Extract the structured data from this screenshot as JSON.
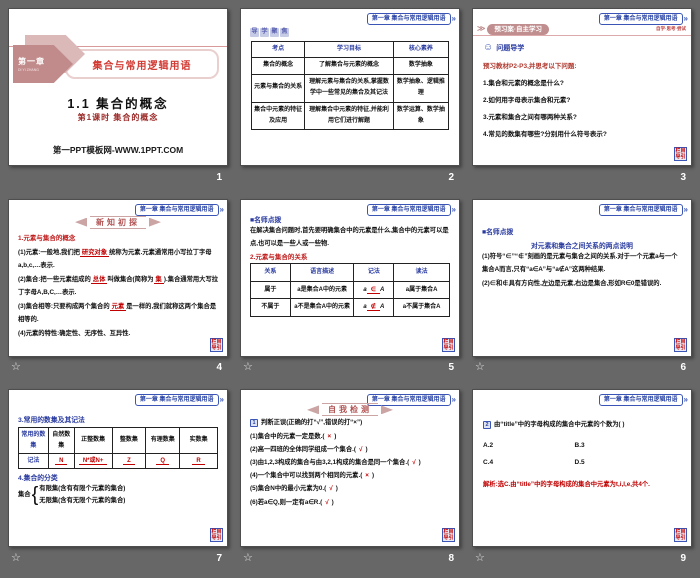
{
  "icons": {
    "chevron": "»",
    "section_chevron": "≫",
    "star": "☆",
    "smiley": "☺"
  },
  "chrome": {
    "chapter_header": "第一章 集合与常用逻辑用语",
    "corner_badge": "栏目导引"
  },
  "s1": {
    "number": "1",
    "chapter": "第一章",
    "chapter_pinyin": "DI YI ZHANG",
    "banner": "集合与常用逻辑用语",
    "title": "1.1 集合的概念",
    "subtitle": "第1课时 集合的概念",
    "footer": "第一PPT模板网-WWW.1PPT.COM"
  },
  "s2": {
    "number": "2",
    "badge": "导学聚焦",
    "headers": [
      "考点",
      "学习目标",
      "核心素养"
    ],
    "rows": [
      [
        "集合的概念",
        "了解集合与元素的概念",
        "数学抽象"
      ],
      [
        "元素与集合的关系",
        "理解元素与集合的关系,掌握数学中一些常见的集合及其记法",
        "数学抽象、逻辑推理"
      ],
      [
        "集合中元素的特征及应用",
        "理解集合中元素的特征,并能利用它们进行解题",
        "数学运算、数学抽象"
      ]
    ]
  },
  "s3": {
    "number": "3",
    "section": "预习案·自主学习",
    "tagline": "自学·思考·尝试",
    "heading": "问题导学",
    "intro": "预习教材P2-P3,并思考以下问题:",
    "items": [
      "1.集合和元素的概念是什么?",
      "2.如何用字母表示集合和元素?",
      "3.元素和集合之间有哪两种关系?",
      "4.常见的数集有哪些?分别用什么符号表示?"
    ]
  },
  "s4": {
    "number": "4",
    "badge": "新知初探",
    "heading": "1.元素与集合的概念",
    "p1a": "(1)元素:一般地,我们把",
    "p1b": "研究对象",
    "p1c": "统称为元素.元素通常用小写拉丁字母a,b,c,…表示.",
    "p2a": "(2)集合:把一些元素组成的",
    "p2b": "总体",
    "p2c": "叫做集合(简称为",
    "p2d": "集",
    "p2e": ").集合通常用大写拉丁字母A,B,C,…表示.",
    "p3a": "(3)集合相等:只要构成两个集合的",
    "p3b": "元素",
    "p3c": "是一样的,我们就称这两个集合是相等的.",
    "p4": "(4)元素的特性:确定性、无序性、互异性."
  },
  "s5": {
    "number": "5",
    "note_heading": "■名师点拨",
    "note_text": "在解决集合问题时,首先要明确集合中的元素是什么,集合中的元素可以是点,也可以是一些人或一些物.",
    "heading": "2.元素与集合的关系",
    "headers": [
      "关系",
      "语言描述",
      "记法",
      "读法"
    ],
    "r1": {
      "rel": "属于",
      "desc": "a是集合A中的元素",
      "pre": "a",
      "sym": "∈",
      "post": "A",
      "read": "a属于集合A"
    },
    "r2": {
      "rel": "不属于",
      "desc": "a不是集合A中的元素",
      "pre": "a",
      "sym": "∉",
      "post": "A",
      "read": "a不属于集合A"
    }
  },
  "s6": {
    "number": "6",
    "note_heading": "■名师点拨",
    "subtitle": "对元素和集合之间关系的两点说明",
    "p1": "(1)符号“∈”“∉”刻画的是元素与集合之间的关系.对于一个元素a与一个集合A而言,只有“a∈A”与“a∉A”这两种结果.",
    "p2": "(2)∈和∉具有方向性,左边是元素,右边是集合,形如R∈0是错误的."
  },
  "s7": {
    "number": "7",
    "heading": "3.常用的数集及其记法",
    "row1": [
      "常用的数集",
      "自然数集",
      "正整数集",
      "整数集",
      "有理数集",
      "实数集"
    ],
    "row2_label": "记法",
    "row2": [
      "N",
      "N*或N+",
      "Z",
      "Q",
      "R"
    ],
    "heading2": "4.集合的分类",
    "brace_label": "集合",
    "line1": "有限集(含有有限个元素的集合)",
    "line2": "无限集(含有无限个元素的集合)"
  },
  "s8": {
    "number": "8",
    "badge": "自我检测",
    "lead_num": "1",
    "lead": "判断正误(正确的打“√”,错误的打“×”)",
    "items": [
      {
        "q": "(1)集合中的元素一定是数.(",
        "m": "×",
        "e": ")"
      },
      {
        "q": "(2)高一四班的全体同学组成一个集合.(",
        "m": "√",
        "e": ")"
      },
      {
        "q": "(3)由1,2,3构成的集合与由3,2,1构成的集合是同一个集合.(",
        "m": "√",
        "e": ")"
      },
      {
        "q": "(4)一个集合中可以找到两个相同的元素.(",
        "m": "×",
        "e": ")"
      },
      {
        "q": "(5)集合N中的最小元素为0.(",
        "m": "√",
        "e": ")"
      },
      {
        "q": "(6)若a∈Q,则一定有a∈R.(",
        "m": "√",
        "e": ")"
      }
    ]
  },
  "s9": {
    "number": "9",
    "lead_num": "2",
    "question": "由“title”中的字母构成的集合中元素的个数为(    )",
    "options": [
      "A.2",
      "B.3",
      "C.4",
      "D.5"
    ],
    "analysis": "解析:选C.由“title”中的字母构成的集合中元素为t,i,l,e,共4个."
  }
}
